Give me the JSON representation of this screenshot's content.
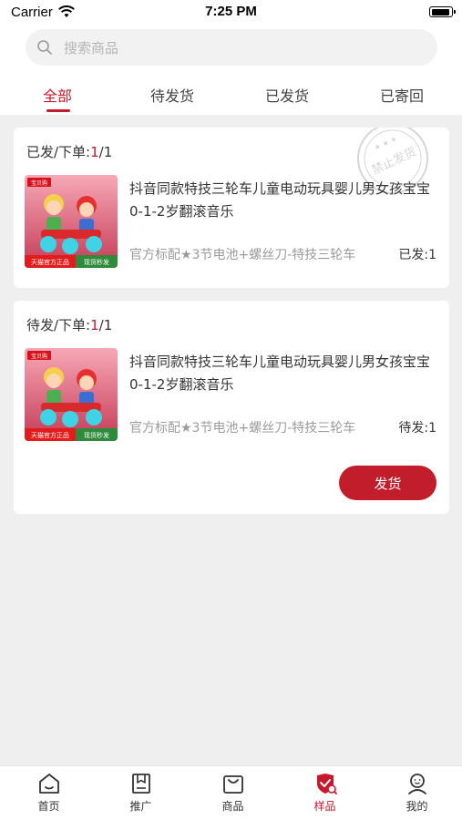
{
  "status_bar": {
    "carrier": "Carrier",
    "time": "7:25 PM",
    "battery_level": 0.95
  },
  "search": {
    "placeholder": "搜索商品",
    "value": ""
  },
  "tabs": [
    {
      "label": "全部",
      "active": true
    },
    {
      "label": "待发货",
      "active": false
    },
    {
      "label": "已发货",
      "active": false
    },
    {
      "label": "已寄回",
      "active": false
    }
  ],
  "orders": [
    {
      "status_label": "已发/下单:",
      "count_current": "1",
      "count_total": "/1",
      "stamp_text": "禁止发货",
      "product": {
        "title": "抖音同款特技三轮车儿童电动玩具婴儿男女孩宝宝0-1-2岁翻滚音乐",
        "spec": "官方标配★3节电池+螺丝刀-特技三轮车",
        "qty_label": "已发:1",
        "thumb_badge_top": "宝贝购",
        "thumb_badge_left": "天猫官方正品",
        "thumb_badge_right": "现货秒发"
      }
    },
    {
      "status_label": "待发/下单:",
      "count_current": "1",
      "count_total": "/1",
      "product": {
        "title": "抖音同款特技三轮车儿童电动玩具婴儿男女孩宝宝0-1-2岁翻滚音乐",
        "spec": "官方标配★3节电池+螺丝刀-特技三轮车",
        "qty_label": "待发:1",
        "thumb_badge_top": "宝贝购",
        "thumb_badge_left": "天猫官方正品",
        "thumb_badge_right": "现货秒发"
      },
      "action_label": "发货"
    }
  ],
  "bottom_nav": [
    {
      "label": "首页",
      "icon": "home-icon"
    },
    {
      "label": "推广",
      "icon": "bookmark-icon"
    },
    {
      "label": "商品",
      "icon": "shopping-bag-icon"
    },
    {
      "label": "样品",
      "icon": "shield-check-icon",
      "active": true
    },
    {
      "label": "我的",
      "icon": "user-icon"
    }
  ],
  "colors": {
    "accent": "#c8182c",
    "button": "#c21d2a",
    "background": "#efefef"
  }
}
